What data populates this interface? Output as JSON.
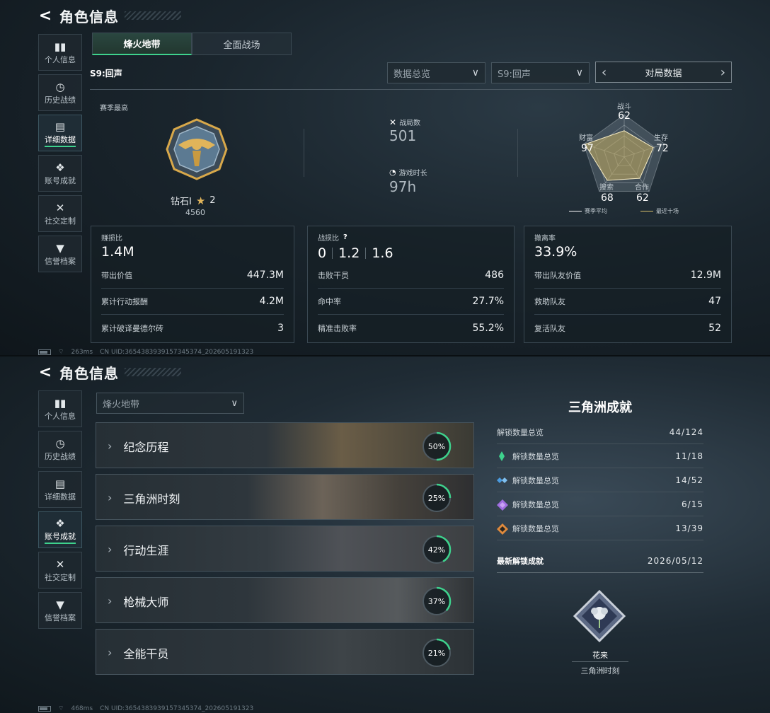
{
  "top": {
    "header": {
      "back_icon": "back-arrow-icon",
      "title": "角色信息"
    },
    "sidebar": [
      {
        "label": "个人信息",
        "icon": "bar-chart-icon"
      },
      {
        "label": "历史战绩",
        "icon": "clock-icon"
      },
      {
        "label": "详细数据",
        "icon": "folder-icon"
      },
      {
        "label": "账号成就",
        "icon": "medal-icon"
      },
      {
        "label": "社交定制",
        "icon": "tools-icon"
      },
      {
        "label": "信誉档案",
        "icon": "shield-icon"
      }
    ],
    "active_sidebar": "详细数据",
    "tabs": [
      "烽火地带",
      "全面战场"
    ],
    "active_tab": "烽火地带",
    "season": "S9:回声",
    "dropdowns": {
      "overview": "数据总览",
      "season": "S9:回声",
      "match": "对局数据"
    },
    "rank": {
      "label": "赛季最高",
      "tier": "钻石I",
      "stars": "2",
      "points": "4560"
    },
    "battles": {
      "label": "战局数",
      "value": "501"
    },
    "playtime": {
      "label": "游戏时长",
      "value": "97h"
    },
    "radar": {
      "axes": [
        {
          "label": "战斗",
          "value": "62"
        },
        {
          "label": "生存",
          "value": "72"
        },
        {
          "label": "合作",
          "value": "62"
        },
        {
          "label": "搜索",
          "value": "68"
        },
        {
          "label": "财富",
          "value": "97"
        }
      ],
      "legend": [
        "赛季平均",
        "最近十场"
      ],
      "colors": {
        "avg": "#ffffff",
        "recent": "#d8c06a"
      }
    },
    "cards": [
      {
        "title": "赚损比",
        "big": "1.4M",
        "rows": [
          {
            "k": "带出价值",
            "v": "447.3M"
          },
          {
            "k": "累计行动报酬",
            "v": "4.2M"
          },
          {
            "k": "累计破译曼德尔砖",
            "v": "3"
          }
        ]
      },
      {
        "title": "战损比",
        "big_parts": [
          "0",
          "1.2",
          "1.6"
        ],
        "rows": [
          {
            "k": "击败干员",
            "v": "486"
          },
          {
            "k": "命中率",
            "v": "27.7%"
          },
          {
            "k": "精准击败率",
            "v": "55.2%"
          }
        ]
      },
      {
        "title": "撤离率",
        "big": "33.9%",
        "rows": [
          {
            "k": "带出队友价值",
            "v": "12.9M"
          },
          {
            "k": "救助队友",
            "v": "47"
          },
          {
            "k": "复活队友",
            "v": "52"
          }
        ]
      }
    ],
    "footer": {
      "ping": "263ms",
      "uid": "CN UID:3654383939157345374_202605191323"
    }
  },
  "bottom": {
    "header": {
      "back_icon": "back-arrow-icon",
      "title": "角色信息"
    },
    "active_sidebar": "账号成就",
    "mode_dropdown": "烽火地带",
    "categories": [
      {
        "name": "纪念历程",
        "percent": 50
      },
      {
        "name": "三角洲时刻",
        "percent": 25
      },
      {
        "name": "行动生涯",
        "percent": 42
      },
      {
        "name": "枪械大师",
        "percent": 37
      },
      {
        "name": "全能干员",
        "percent": 21
      }
    ],
    "ring_color": "#3ed28d",
    "summary_title": "三角洲成就",
    "summary": [
      {
        "label": "解锁数量总览",
        "value": "44/124",
        "gem": null
      },
      {
        "label": "解锁数量总览",
        "value": "11/18",
        "gem": "#3ed28d"
      },
      {
        "label": "解锁数量总览",
        "value": "14/52",
        "gem": "#4a9be0"
      },
      {
        "label": "解锁数量总览",
        "value": "6/15",
        "gem": "#a06ee0"
      },
      {
        "label": "解锁数量总览",
        "value": "13/39",
        "gem": "#e08a3c"
      }
    ],
    "latest": {
      "label": "最新解锁成就",
      "date": "2026/05/12",
      "name": "花来",
      "category": "三角洲时刻"
    },
    "footer": {
      "ping": "468ms",
      "uid": "CN UID:3654383939157345374_202605191323"
    }
  }
}
